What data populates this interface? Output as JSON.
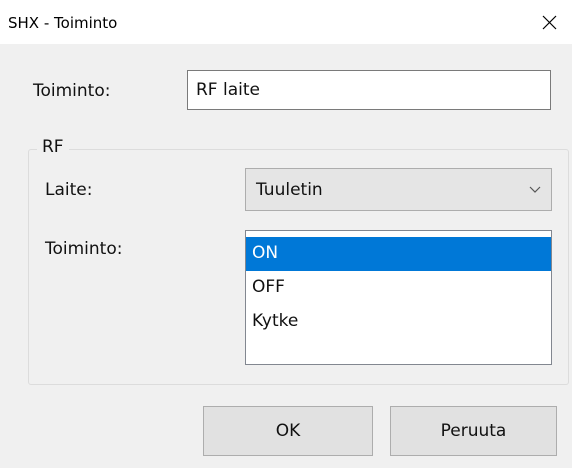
{
  "window": {
    "title": "SHX - Toiminto",
    "close_icon": "close-icon"
  },
  "form": {
    "name_label": "Toiminto:",
    "name_value": "RF laite"
  },
  "rf_group": {
    "title": "RF",
    "device_label": "Laite:",
    "device_selected": "Tuuletin",
    "dropdown_icon": "chevron-down-icon",
    "action_label": "Toiminto:",
    "action_items": [
      {
        "label": "ON",
        "selected": true
      },
      {
        "label": "OFF",
        "selected": false
      },
      {
        "label": "Kytke",
        "selected": false
      }
    ]
  },
  "buttons": {
    "ok_label": "OK",
    "cancel_label": "Peruuta"
  },
  "colors": {
    "selection": "#0078d7",
    "dialog_background": "#f0f0f0"
  }
}
